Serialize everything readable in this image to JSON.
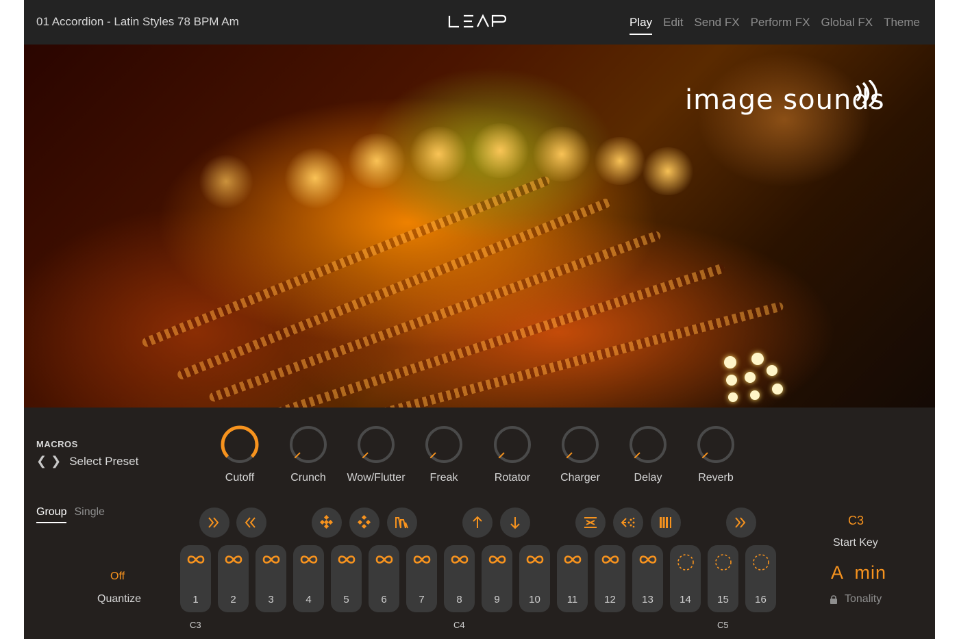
{
  "header": {
    "preset_name": "01 Accordion - Latin Styles 78 BPM Am",
    "logo_text": "LEAP",
    "tabs": [
      {
        "label": "Play",
        "active": true
      },
      {
        "label": "Edit",
        "active": false
      },
      {
        "label": "Send FX",
        "active": false
      },
      {
        "label": "Perform FX",
        "active": false
      },
      {
        "label": "Global FX",
        "active": false
      },
      {
        "label": "Theme",
        "active": false
      }
    ]
  },
  "hero": {
    "brand": "image sounds"
  },
  "macros": {
    "label": "MACROS",
    "preset_select": "Select Preset",
    "knobs": [
      {
        "label": "Cutoff",
        "value": 1.0
      },
      {
        "label": "Crunch",
        "value": 0.0
      },
      {
        "label": "Wow/Flutter",
        "value": 0.0
      },
      {
        "label": "Freak",
        "value": 0.0
      },
      {
        "label": "Rotator",
        "value": 0.0
      },
      {
        "label": "Charger",
        "value": 0.0
      },
      {
        "label": "Delay",
        "value": 0.0
      },
      {
        "label": "Reverb",
        "value": 0.0
      }
    ]
  },
  "mode": {
    "tabs": [
      {
        "label": "Group",
        "active": true
      },
      {
        "label": "Single",
        "active": false
      }
    ]
  },
  "fx_buttons": [
    {
      "name": "double-forward-icon"
    },
    {
      "name": "double-back-icon"
    },
    {
      "name": "stutter-icon"
    },
    {
      "name": "stutter-alt-icon"
    },
    {
      "name": "filter-shape-icon"
    },
    {
      "name": "pitch-up-icon"
    },
    {
      "name": "pitch-down-icon"
    },
    {
      "name": "reverse-icon"
    },
    {
      "name": "scatter-icon"
    },
    {
      "name": "gate-icon"
    },
    {
      "name": "double-forward-icon"
    }
  ],
  "pads": [
    {
      "number": "1",
      "mode": "loop"
    },
    {
      "number": "2",
      "mode": "loop"
    },
    {
      "number": "3",
      "mode": "loop"
    },
    {
      "number": "4",
      "mode": "loop"
    },
    {
      "number": "5",
      "mode": "loop"
    },
    {
      "number": "6",
      "mode": "loop"
    },
    {
      "number": "7",
      "mode": "loop"
    },
    {
      "number": "8",
      "mode": "loop"
    },
    {
      "number": "9",
      "mode": "loop"
    },
    {
      "number": "10",
      "mode": "loop"
    },
    {
      "number": "11",
      "mode": "loop"
    },
    {
      "number": "12",
      "mode": "loop"
    },
    {
      "number": "13",
      "mode": "loop"
    },
    {
      "number": "14",
      "mode": "one-shot"
    },
    {
      "number": "15",
      "mode": "one-shot"
    },
    {
      "number": "16",
      "mode": "one-shot"
    }
  ],
  "note_labels": [
    "C3",
    "C4",
    "C5"
  ],
  "quantize": {
    "value": "Off",
    "label": "Quantize"
  },
  "start_key": {
    "value": "C3",
    "label": "Start Key"
  },
  "tonality": {
    "value": "A  min",
    "label": "Tonality"
  },
  "colors": {
    "accent": "#f7931e",
    "panel": "#242424",
    "pad": "#3a3a3a"
  }
}
